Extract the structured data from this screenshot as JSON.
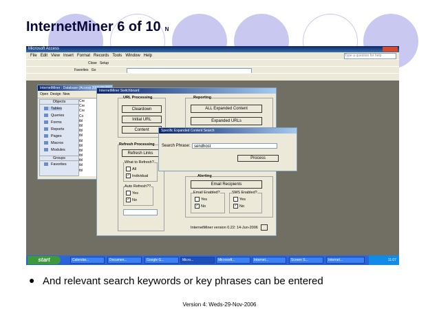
{
  "slide": {
    "title": "InternetMiner 6 of 10",
    "title_suffix": "N",
    "bullet": "And relevant search keywords or key phrases can be entered",
    "footer": "Version 4: Weds-29-Nov-2006"
  },
  "access": {
    "title": "Microsoft Access",
    "menu": [
      "File",
      "Edit",
      "View",
      "Insert",
      "Format",
      "Records",
      "Tools",
      "Window",
      "Help"
    ],
    "help_box": "Type a question for help",
    "toolbar_close": "Close",
    "toolbar_setup": "Setup",
    "toolbar_favorites": "Favorites",
    "toolbar_go": "Go"
  },
  "db_window": {
    "title": "InternetMiner : Database (Access 2000 file for...",
    "open": "Open",
    "design": "Design",
    "new": "New",
    "objects_header": "Objects",
    "objects": [
      "Tables",
      "Queries",
      "Forms",
      "Reports",
      "Pages",
      "Macros",
      "Modules"
    ],
    "groups_header": "Groups",
    "groups": [
      "Favorites"
    ],
    "list": [
      "Cre",
      "Cre",
      "Cre",
      "Co",
      "tbl",
      "tbl",
      "tbl",
      "tbl",
      "tbl",
      "tbl",
      "tbl",
      "tbl",
      "tbl",
      "tbl",
      "tbl"
    ]
  },
  "switchboard": {
    "title": "InternetMiner Switchboard",
    "url_processing": "URL Processing",
    "cleardown": "Cleardown",
    "initial_url": "Initial URL",
    "content": "Content",
    "refresh_processing": "Refresh Processing",
    "refresh_links": "Refresh Links",
    "what_to_refresh": "What to Refresh?",
    "all": "All",
    "individual": "Individual",
    "auto_refresh": "Auto Refresh??",
    "yes": "Yes",
    "no": "No",
    "reporting": "Reporting",
    "all_expanded": "ALL Expanded Content",
    "expanded_url": "Expanded URLs",
    "alerting": "Alerting",
    "email_recipients": "Email Recipients",
    "email_enabled": "Email Enabled?",
    "sms_enabled": "SMS Enabled?",
    "version": "InternetMiner version 0.22: 14-Jun-2006"
  },
  "search_dialog": {
    "title": "Specific Expanded Content Search",
    "phrase_label": "Search Phrase:",
    "phrase_value": "sendhost",
    "process": "Process"
  },
  "taskbar": {
    "start": "start",
    "tasks": [
      "Calendar...",
      "Documen...",
      "Google G...",
      "Micro...",
      "Microsoft...",
      "Internet...",
      "Screen S...",
      "Internet..."
    ],
    "clock": "11:07"
  },
  "colors": {
    "title_text": "#0a0a3a",
    "circle_fill": "#c8c8f0",
    "circle_ring": "#c8c8f0",
    "workspace": "#716f64",
    "taskbar": "#245edb"
  }
}
